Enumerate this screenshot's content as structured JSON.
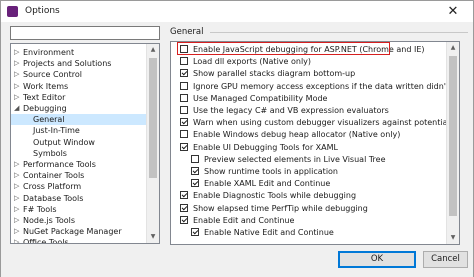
{
  "window": {
    "title": "Options",
    "close_glyph": "✕"
  },
  "search": {
    "placeholder": ""
  },
  "tree": {
    "items": [
      {
        "label": "Environment",
        "expanded": false
      },
      {
        "label": "Projects and Solutions",
        "expanded": false
      },
      {
        "label": "Source Control",
        "expanded": false
      },
      {
        "label": "Work Items",
        "expanded": false
      },
      {
        "label": "Text Editor",
        "expanded": false
      },
      {
        "label": "Debugging",
        "expanded": true
      },
      {
        "label": "General",
        "selected": true
      },
      {
        "label": "Just-In-Time"
      },
      {
        "label": "Output Window"
      },
      {
        "label": "Symbols"
      },
      {
        "label": "Performance Tools",
        "expanded": false
      },
      {
        "label": "Container Tools",
        "expanded": false
      },
      {
        "label": "Cross Platform",
        "expanded": false
      },
      {
        "label": "Database Tools",
        "expanded": false
      },
      {
        "label": "F# Tools",
        "expanded": false
      },
      {
        "label": "Node.js Tools",
        "expanded": false
      },
      {
        "label": "NuGet Package Manager",
        "expanded": false
      },
      {
        "label": "Office Tools",
        "expanded": false
      }
    ]
  },
  "section": {
    "title": "General"
  },
  "options": [
    {
      "label": "Enable JavaScript debugging for ASP.NET (Chrome and IE)",
      "checked": false,
      "highlighted": true
    },
    {
      "label": "Load dll exports (Native only)",
      "checked": false
    },
    {
      "label": "Show parallel stacks diagram bottom-up",
      "checked": true
    },
    {
      "label": "Ignore GPU memory access exceptions if the data written didn't change the v",
      "checked": false
    },
    {
      "label": "Use Managed Compatibility Mode",
      "checked": false
    },
    {
      "label": "Use the legacy C# and VB expression evaluators",
      "checked": false
    },
    {
      "label": "Warn when using custom debugger visualizers against potentially unsafe pro",
      "checked": true
    },
    {
      "label": "Enable Windows debug heap allocator (Native only)",
      "checked": false
    },
    {
      "label": "Enable UI Debugging Tools for XAML",
      "checked": true
    },
    {
      "label": "Preview selected elements in Live Visual Tree",
      "checked": false,
      "indent": true
    },
    {
      "label": "Show runtime tools in application",
      "checked": true,
      "indent": true
    },
    {
      "label": "Enable XAML Edit and Continue",
      "checked": true,
      "indent": true
    },
    {
      "label": "Enable Diagnostic Tools while debugging",
      "checked": true
    },
    {
      "label": "Show elapsed time PerfTip while debugging",
      "checked": true
    },
    {
      "label": "Enable Edit and Continue",
      "checked": true
    },
    {
      "label": "Enable Native Edit and Continue",
      "checked": true,
      "indent": true
    }
  ],
  "buttons": {
    "ok": "OK",
    "cancel": "Cancel"
  },
  "colors": {
    "highlight_border": "#d61f1f",
    "selection": "#cce8ff",
    "accent": "#0078d7"
  }
}
